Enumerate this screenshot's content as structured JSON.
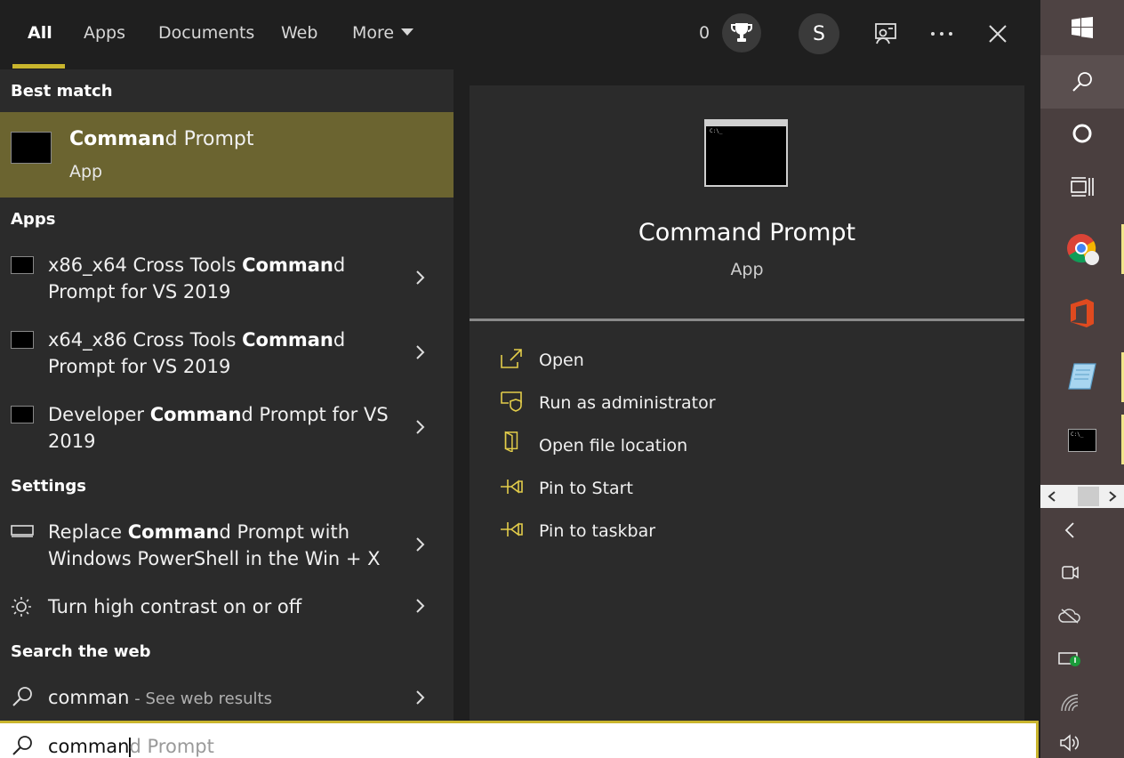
{
  "tabs": [
    {
      "label": "All"
    },
    {
      "label": "Apps"
    },
    {
      "label": "Documents"
    },
    {
      "label": "Web"
    },
    {
      "label": "More"
    }
  ],
  "header": {
    "points": "0",
    "avatar_letter": "S"
  },
  "sections": {
    "best_match": "Best match",
    "apps": "Apps",
    "settings": "Settings",
    "search_web": "Search the web"
  },
  "best_match": {
    "bold": "Comman",
    "rest": "d Prompt",
    "type": "App"
  },
  "apps": [
    {
      "pre": "x86_x64 Cross Tools ",
      "bold": "Comman",
      "post": "d",
      "line2": "Prompt for VS 2019"
    },
    {
      "pre": "x64_x86 Cross Tools ",
      "bold": "Comman",
      "post": "d",
      "line2": "Prompt for VS 2019"
    },
    {
      "pre": "Developer ",
      "bold": "Comman",
      "post": "d Prompt for VS",
      "line2": "2019"
    }
  ],
  "settings": [
    {
      "pre": "Replace ",
      "bold": "Comman",
      "post": "d Prompt with",
      "line2": "Windows PowerShell in the Win + X"
    },
    {
      "pre": "Turn high contrast on or off",
      "bold": "",
      "post": "",
      "line2": ""
    }
  ],
  "web": {
    "query": "comman",
    "suffix": " - See web results"
  },
  "preview": {
    "title": "Command Prompt",
    "subtitle": "App"
  },
  "actions": [
    {
      "label": "Open",
      "icon": "open-icon"
    },
    {
      "label": "Run as administrator",
      "icon": "shield-icon"
    },
    {
      "label": "Open file location",
      "icon": "folder-icon"
    },
    {
      "label": "Pin to Start",
      "icon": "pin-icon"
    },
    {
      "label": "Pin to taskbar",
      "icon": "pin-icon"
    }
  ],
  "search": {
    "typed": "comman",
    "hint": "d Prompt"
  },
  "colors": {
    "accent": "#c9b52d",
    "highlight": "#6b6430",
    "panel": "#2b2b2b"
  }
}
